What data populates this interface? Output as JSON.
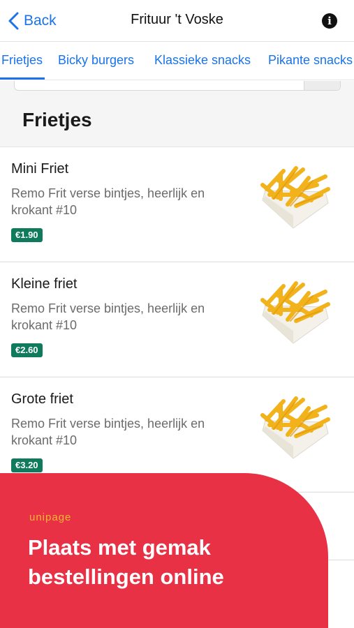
{
  "header": {
    "back_label": "Back",
    "title": "Frituur 't Voske",
    "info_symbol": "i"
  },
  "tabs": [
    {
      "label": "Frietjes",
      "active": true
    },
    {
      "label": "Bicky burgers",
      "active": false
    },
    {
      "label": "Klassieke snacks",
      "active": false
    },
    {
      "label": "Pikante snacks",
      "active": false
    }
  ],
  "section": {
    "title": "Frietjes"
  },
  "items": [
    {
      "name": "Mini Friet",
      "description": "Remo Frit verse bintjes, heerlijk en krokant #10",
      "price": "€1.90",
      "image": "fries-icon"
    },
    {
      "name": "Kleine friet",
      "description": "Remo Frit verse bintjes, heerlijk en krokant #10",
      "price": "€2.60",
      "image": "fries-icon"
    },
    {
      "name": "Grote friet",
      "description": "Remo Frit verse bintjes, heerlijk en krokant #10",
      "price": "€3.20",
      "image": "fries-icon"
    }
  ],
  "banner": {
    "logo": "unipage",
    "headline": "Plaats met gemak bestellingen online"
  },
  "colors": {
    "accent": "#1a73e8",
    "price_badge": "#0f7a5c",
    "banner": "#e83145",
    "logo": "#f7b733"
  }
}
